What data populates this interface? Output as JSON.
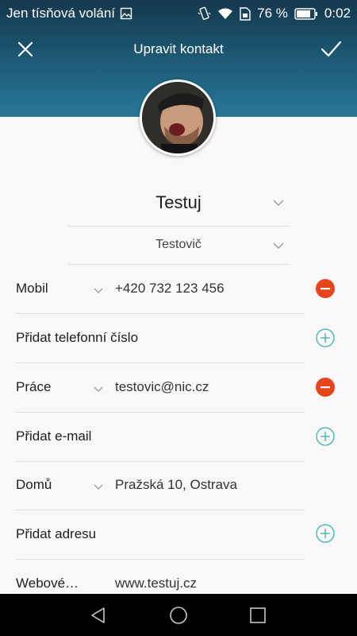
{
  "status_bar": {
    "carrier": "Jen tísňová volání",
    "battery": "76 %",
    "time": "0:02",
    "icons": [
      "image-icon",
      "vibrate-icon",
      "wifi-icon",
      "sim-icon",
      "battery-icon"
    ]
  },
  "toolbar": {
    "title": "Upravit kontakt",
    "close_icon": "close-icon",
    "save_icon": "check-icon"
  },
  "contact": {
    "first_name": "Testuj",
    "last_name": "Testovič"
  },
  "phone": {
    "type_label": "Mobil",
    "value": "+420 732 123 456",
    "add_label": "Přidat telefonní číslo"
  },
  "email": {
    "type_label": "Práce",
    "value": "testovic@nic.cz",
    "add_label": "Přidat e-mail"
  },
  "address": {
    "type_label": "Domů",
    "value": "Pražská 10, Ostrava",
    "add_label": "Přidat adresu"
  },
  "website": {
    "type_label": "Webové…",
    "value": "www.testuj.cz"
  },
  "colors": {
    "header_top": "#15384d",
    "header_bottom": "#2a7896",
    "remove_red": "#e8451c",
    "add_teal": "#36b3b0",
    "nav_bar": "#000000"
  },
  "nav": {
    "icons": [
      "back-icon",
      "home-icon",
      "recents-icon"
    ]
  }
}
